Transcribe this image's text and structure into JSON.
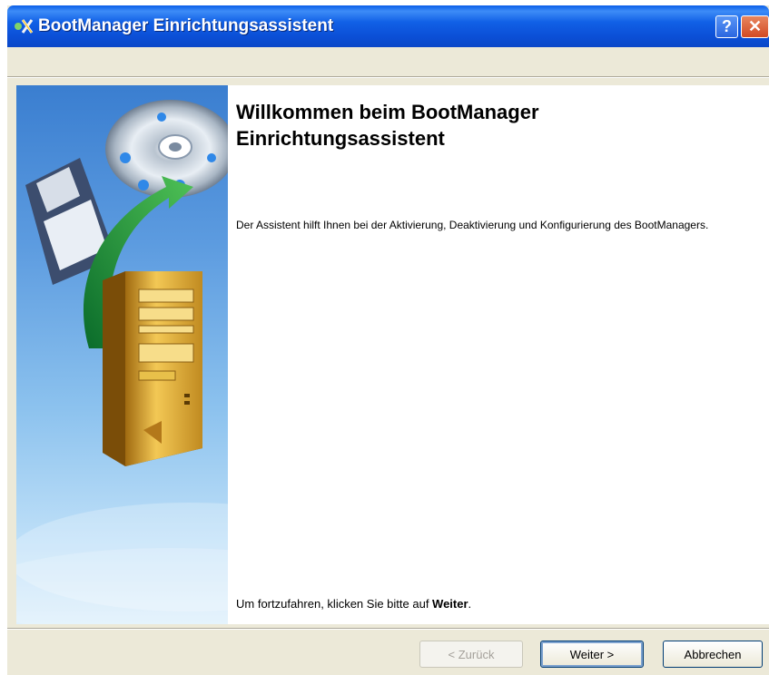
{
  "window": {
    "title": "BootManager Einrichtungsassistent",
    "help_label": "?",
    "close_label": "✕",
    "accent": "#0a5fe9"
  },
  "welcome": {
    "heading_line1": "Willkommen beim BootManager",
    "heading_line2": "Einrichtungsassistent",
    "description": "Der Assistent hilft Ihnen bei der Aktivierung, Deaktivierung und Konfigurierung des BootManagers.",
    "continue_prefix": "Um fortzufahren, klicken Sie bitte auf ",
    "continue_keyword": "Weiter",
    "continue_suffix": "."
  },
  "buttons": {
    "back": "< Zurück",
    "next": "Weiter >",
    "cancel": "Abbrechen"
  },
  "icons": [
    "wizard-app-icon",
    "help-icon",
    "close-icon",
    "floppy-disk-icon",
    "cd-disc-icon",
    "transfer-arrow-icon",
    "computer-tower-icon"
  ]
}
